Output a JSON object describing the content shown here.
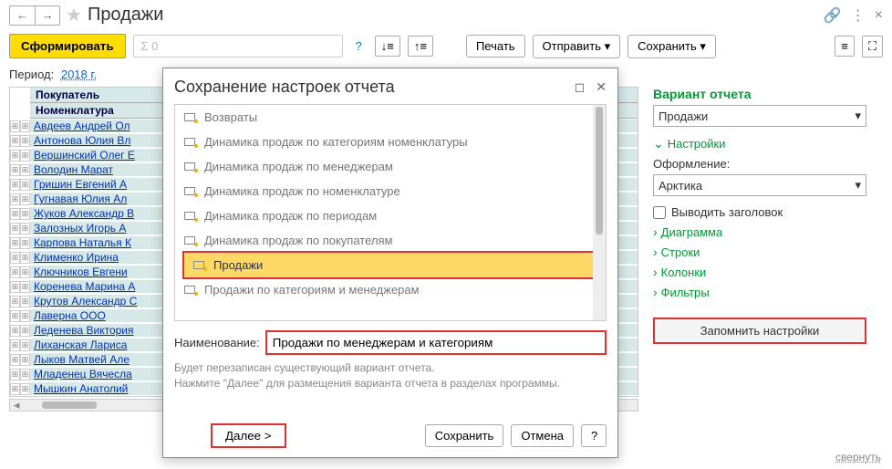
{
  "header": {
    "title": "Продажи"
  },
  "toolbar": {
    "generate": "Сформировать",
    "searchPlaceholder": "Σ 0",
    "print": "Печать",
    "send": "Отправить",
    "save": "Сохранить"
  },
  "period": {
    "label": "Период:",
    "value": "2018 г."
  },
  "grid": {
    "h1": "Покупатель",
    "h2": "Номенклатура",
    "rows": [
      "Авдеев Андрей Ол",
      "Антонова Юлия Вл",
      "Вершинский Олег Е",
      "Володин Марат",
      "Гришин Евгений А",
      "Гугнавая Юлия Ал",
      "Жуков Александр В",
      "Залозных Игорь А",
      "Карпова Наталья К",
      "Клименко Ирина",
      "Ключников Евгени",
      "Коренева Марина А",
      "Крутов Александр С",
      "Лаверна ООО",
      "Леденева Виктория",
      "Лиханская Лариса",
      "Лыков Матвей Але",
      "Младенец Вячесла",
      "Мышкин Анатолий"
    ]
  },
  "sidebar": {
    "variantTitle": "Вариант отчета",
    "variantValue": "Продажи",
    "settings": "Настройки",
    "formatLabel": "Оформление:",
    "formatValue": "Арктика",
    "showHeader": "Выводить заголовок",
    "diagram": "Диаграмма",
    "rows": "Строки",
    "columns": "Колонки",
    "filters": "Фильтры",
    "remember": "Запомнить настройки"
  },
  "collapse": "свернуть",
  "dialog": {
    "title": "Сохранение настроек отчета",
    "items": [
      "Возвраты",
      "Динамика продаж по категориям номенклатуры",
      "Динамика продаж по менеджерам",
      "Динамика продаж по номенклатуре",
      "Динамика продаж по периодам",
      "Динамика продаж по покупателям",
      "Продажи",
      "Продажи по категориям и менеджерам"
    ],
    "selectedIndex": 6,
    "nameLabel": "Наименование:",
    "nameValue": "Продажи по менеджерам и категориям",
    "hint": "Будет перезаписан существующий вариант отчета.\nНажмите \"Далее\" для размещения варианта отчета в разделах программы.",
    "next": "Далее  >",
    "save": "Сохранить",
    "cancel": "Отмена",
    "help": "?"
  }
}
